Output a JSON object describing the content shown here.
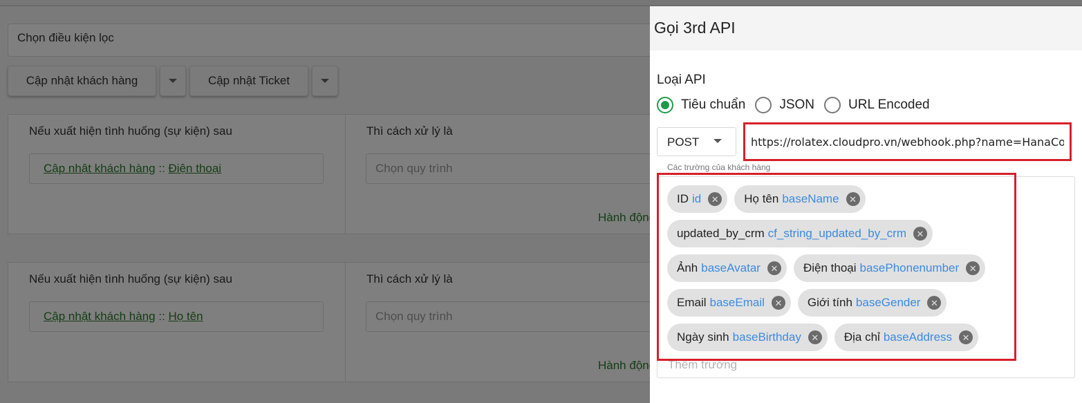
{
  "background": {
    "filter_placeholder": "Chọn điều kiện lọc",
    "buttons": {
      "update_customer": "Cập nhật khách hàng",
      "update_ticket": "Cập nhật Ticket"
    },
    "rules": [
      {
        "if_label": "Nếu xuất hiện tình huống (sự kiện) sau",
        "then_label": "Thì cách xử lý là",
        "trigger_object": "Cập nhật khách hàng",
        "trigger_separator": " :: ",
        "trigger_field": "Điện thoại",
        "process_placeholder": "Chọn quy trình",
        "action_label": "Hành động"
      },
      {
        "if_label": "Nếu xuất hiện tình huống (sự kiện) sau",
        "then_label": "Thì cách xử lý là",
        "trigger_object": "Cập nhật khách hàng",
        "trigger_separator": " :: ",
        "trigger_field": "Họ tên",
        "process_placeholder": "Chọn quy trình",
        "action_label": "Hành động"
      }
    ]
  },
  "panel": {
    "title": "Gọi 3rd API",
    "api_type_label": "Loại API",
    "api_types": [
      {
        "label": "Tiêu chuẩn",
        "checked": true
      },
      {
        "label": "JSON",
        "checked": false
      },
      {
        "label": "URL Encoded",
        "checked": false
      }
    ],
    "method": "POST",
    "url": "https://rolatex.cloudpro.vn/webhook.php?name=HanaConnect",
    "fields_caption": "Các trường của khách hàng",
    "add_field_placeholder": "Thêm trường",
    "tags": [
      {
        "name": "ID",
        "key": "id"
      },
      {
        "name": "Họ tên",
        "key": "baseName"
      },
      {
        "name": "updated_by_crm",
        "key": "cf_string_updated_by_crm"
      },
      {
        "name": "Ảnh",
        "key": "baseAvatar"
      },
      {
        "name": "Điện thoại",
        "key": "basePhonenumber"
      },
      {
        "name": "Email",
        "key": "baseEmail"
      },
      {
        "name": "Giới tính",
        "key": "baseGender"
      },
      {
        "name": "Ngày sinh",
        "key": "baseBirthday"
      },
      {
        "name": "Địa chỉ",
        "key": "baseAddress"
      }
    ],
    "remove_glyph": "✕"
  },
  "colors": {
    "accent_green": "#1e9a4a",
    "link_green": "#2a7a2a",
    "tag_key_blue": "#3d8ae0",
    "highlight_red": "#d6202a"
  }
}
